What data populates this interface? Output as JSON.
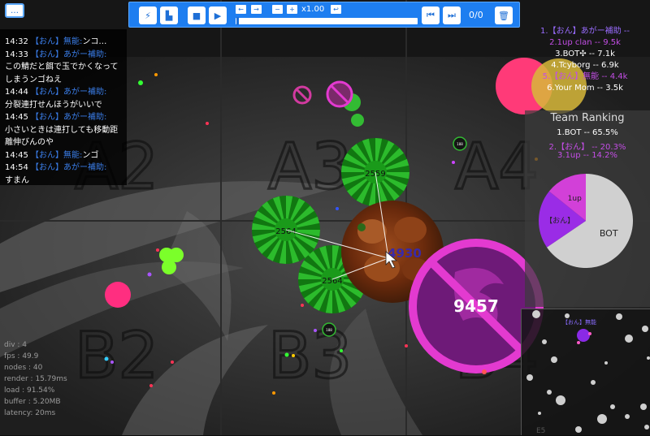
{
  "toolbar": {
    "speed": "x1.00",
    "counter": "0/0"
  },
  "chat": [
    {
      "time": "14:32",
      "name": "【おん】無能:",
      "text": "ンコ…"
    },
    {
      "time": "14:33",
      "name": "【おん】あがー補助:",
      "text": ""
    },
    {
      "time": "",
      "name": "",
      "text": "この鯖だと餌で玉でかくなって"
    },
    {
      "time": "",
      "name": "",
      "text": "しまうンゴねえ"
    },
    {
      "time": "14:44",
      "name": "【おん】あがー補助:",
      "text": ""
    },
    {
      "time": "",
      "name": "",
      "text": "分裂連打せんほうがいいで"
    },
    {
      "time": "14:45",
      "name": "【おん】あがー補助:",
      "text": ""
    },
    {
      "time": "",
      "name": "",
      "text": "小さいときは連打しても移動距"
    },
    {
      "time": "",
      "name": "",
      "text": "離伸びんのや"
    },
    {
      "time": "14:45",
      "name": "【おん】無能:",
      "text": "ンゴ"
    },
    {
      "time": "14:54",
      "name": "【おん】あがー補助:",
      "text": ""
    },
    {
      "time": "",
      "name": "",
      "text": "すまん"
    }
  ],
  "leaderboard": [
    {
      "text": "1.【おん】あがー補助 --",
      "color": "#9a6cff"
    },
    {
      "text": "2.1up clan -- 9.5k",
      "color": "#c44ee6"
    },
    {
      "text": "3.BOT✣ -- 7.1k",
      "color": "#ffffff"
    },
    {
      "text": "4.Tcyborg -- 6.9k",
      "color": "#ffffff"
    },
    {
      "text": "5.【おん】無能 -- 4.4k",
      "color": "#c44ee6"
    },
    {
      "text": "6.Your Mom -- 3.5k",
      "color": "#ffffff"
    }
  ],
  "team_ranking": {
    "title": "Team Ranking",
    "rows": [
      {
        "text": "1.BOT -- 65.5%",
        "color": "#ffffff"
      },
      {
        "text": "2.【おん】 -- 20.3%",
        "color": "#c44ee6"
      },
      {
        "text": "3.1up -- 14.2%",
        "color": "#c44ee6"
      }
    ],
    "pie": [
      {
        "label": "BOT",
        "value": 65.5,
        "color": "#d0d0d0"
      },
      {
        "label": "【おん】",
        "value": 20.3,
        "color": "#9a2ce6"
      },
      {
        "label": "1up",
        "value": 14.2,
        "color": "#d240d8"
      }
    ]
  },
  "grid_labels": [
    "A2",
    "A3",
    "A4",
    "B2",
    "B3",
    "B4"
  ],
  "cells": {
    "big_mass": "9457",
    "food_mass": "4930",
    "green1": "2559",
    "green2": "2564",
    "green3": "2564",
    "small1": "188",
    "small2": "188",
    "pink_top": "258"
  },
  "stats": [
    "div : 4",
    "fps : 49.9",
    "nodes : 40",
    "render : 15.79ms",
    "load : 91.54%",
    "buffer : 5.20MB",
    "latency: 20ms"
  ],
  "minimap": {
    "player_label": "【おん】無能",
    "sector": "E5"
  }
}
